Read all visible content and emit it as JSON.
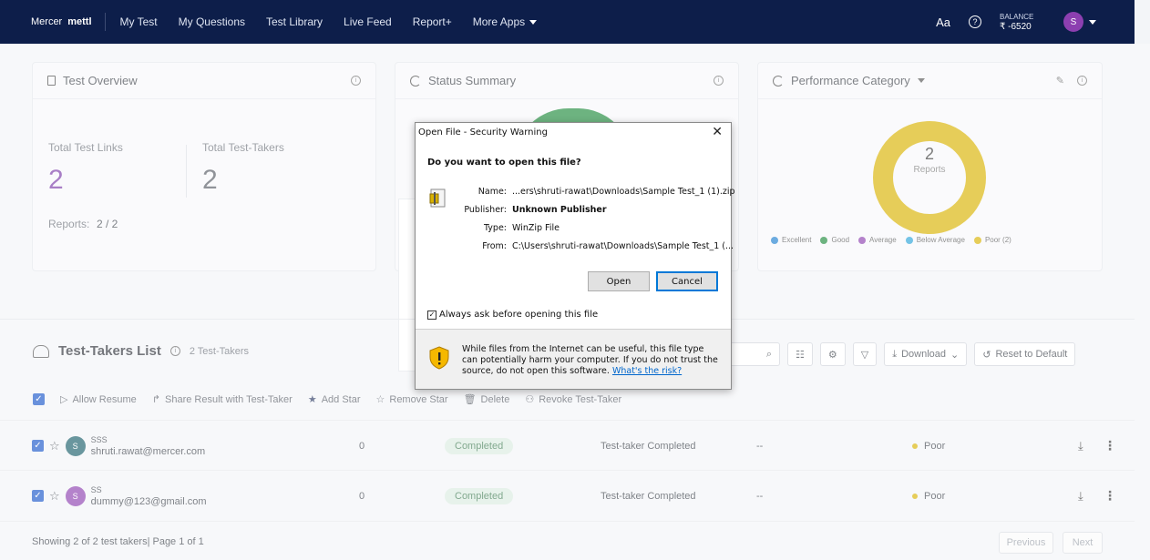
{
  "nav": {
    "logo_brand1": "Mercer",
    "logo_brand2": "mettl",
    "items": [
      "My Test",
      "My Questions",
      "Test Library",
      "Live Feed",
      "Report+",
      "More Apps"
    ],
    "font_toggle": "Aa",
    "help": "?",
    "balance_label": "BALANCE",
    "balance_amount": "₹ -6520",
    "avatar": "S"
  },
  "cards": {
    "overview": {
      "title": "Test Overview",
      "total_links_label": "Total Test Links",
      "total_links": "2",
      "total_takers_label": "Total Test-Takers",
      "total_takers": "2",
      "reports_label": "Reports:",
      "reports_value": "2 / 2"
    },
    "status": {
      "title": "Status Summary"
    },
    "performance": {
      "title": "Performance Category",
      "donut_value": "2",
      "donut_label": "Reports",
      "legend": [
        {
          "label": "Excellent",
          "color": "#1e7fd0"
        },
        {
          "label": "Good",
          "color": "#1f8a3c"
        },
        {
          "label": "Average",
          "color": "#8c3fb0"
        },
        {
          "label": "Below Average",
          "color": "#2aa3d9"
        },
        {
          "label": "Poor (2)",
          "color": "#d9b200"
        }
      ]
    }
  },
  "list": {
    "title": "Test-Takers List",
    "count_label": "2 Test-Takers",
    "download_label": "Download",
    "reset_label": "Reset to Default",
    "actions": {
      "allow_resume": "Allow Resume",
      "share_result": "Share Result with Test-Taker",
      "add_star": "Add Star",
      "remove_star": "Remove Star",
      "delete": "Delete",
      "revoke": "Revoke Test-Taker"
    },
    "rows": [
      {
        "initial": "S",
        "name": "SSS",
        "email": "shruti.rawat@mercer.com",
        "score": "0",
        "status": "Completed",
        "result": "Test-taker Completed",
        "dash": "--",
        "category": "Poor",
        "avatar_color": "#1a5e6a"
      },
      {
        "initial": "S",
        "name": "SS",
        "email": "dummy@123@gmail.com",
        "score": "0",
        "status": "Completed",
        "result": "Test-taker Completed",
        "dash": "--",
        "category": "Poor",
        "avatar_color": "#8c3fb0"
      }
    ],
    "footer_text": "Showing 2 of 2 test takers| Page 1 of 1",
    "prev_label": "Previous",
    "next_label": "Next"
  },
  "dialog": {
    "title": "Open File - Security Warning",
    "question": "Do you want to open this file?",
    "name_key": "Name:",
    "name_val": "...ers\\shruti-rawat\\Downloads\\Sample Test_1 (1).zip",
    "publisher_key": "Publisher:",
    "publisher_val": "Unknown Publisher",
    "type_key": "Type:",
    "type_val": "WinZip File",
    "from_key": "From:",
    "from_val": "C:\\Users\\shruti-rawat\\Downloads\\Sample Test_1 (...",
    "open_label": "Open",
    "cancel_label": "Cancel",
    "always_ask": "Always ask before opening this file",
    "warning_text": "While files from the Internet can be useful, this file type can potentially harm your computer. If you do not trust the source, do not open this software.",
    "risk_link": "What's the risk?"
  }
}
